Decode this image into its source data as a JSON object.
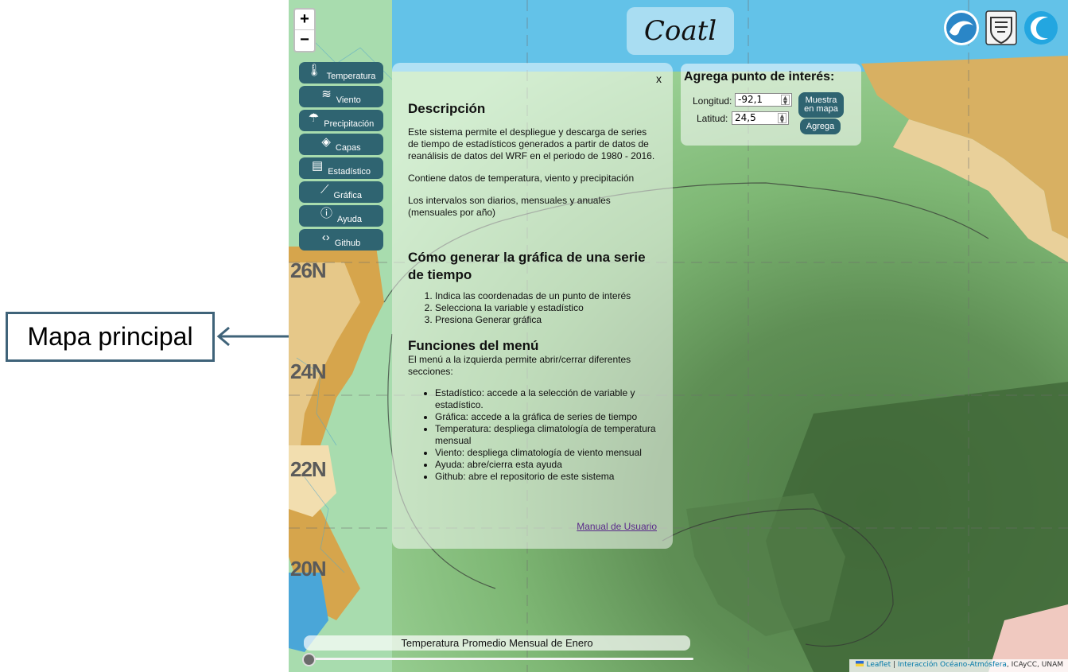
{
  "annotation": {
    "label": "Mapa principal"
  },
  "map": {
    "lat_labels": [
      "26N",
      "24N",
      "22N",
      "20N"
    ],
    "zoom": {
      "in_label": "+",
      "out_label": "−"
    }
  },
  "app": {
    "title": "Coatl"
  },
  "menu": {
    "items": [
      {
        "label": "Temperatura",
        "icon": "thermometer-icon",
        "glyph": "🌡"
      },
      {
        "label": "Viento",
        "icon": "wind-icon",
        "glyph": "≋"
      },
      {
        "label": "Precipitación",
        "icon": "rain-cloud-icon",
        "glyph": "☂"
      },
      {
        "label": "Capas",
        "icon": "layers-icon",
        "glyph": "◈"
      },
      {
        "label": "Estadístico",
        "icon": "document-icon",
        "glyph": "▤"
      },
      {
        "label": "Gráfica",
        "icon": "line-chart-icon",
        "glyph": "⟋"
      },
      {
        "label": "Ayuda",
        "icon": "info-icon",
        "glyph": "ⓘ"
      },
      {
        "label": "Github",
        "icon": "code-icon",
        "glyph": "‹›"
      }
    ]
  },
  "help": {
    "close_label": "x",
    "description_title": "Descripción",
    "description_p1": "Este sistema permite el despliegue y descarga de series de tiempo de estadísticos generados a partir de datos de reanálisis de datos del WRF en el periodo de 1980 - 2016.",
    "description_p2": "Contiene datos de temperatura, viento y precipitación",
    "description_p3": "Los intervalos son diarios, mensuales y anuales (mensuales por año)",
    "howto_title": "Cómo generar la gráfica de una serie de tiempo",
    "howto_steps": [
      "Indica las coordenadas de un punto de interés",
      "Selecciona la variable y estadístico",
      "Presiona Generar gráfica"
    ],
    "functions_title": "Funciones del menú",
    "functions_intro": "El menú a la izquierda permite abrir/cerrar diferentes secciones:",
    "functions_list": [
      "Estadístico: accede a la selección de variable y estadístico.",
      "Gráfica: accede a la gráfica de series de tiempo",
      "Temperatura: despliega climatología de temperatura mensual",
      "Viento: despliega climatología de viento mensual",
      "Ayuda: abre/cierra esta ayuda",
      "Github: abre el repositorio de este sistema"
    ],
    "manual_link": "Manual de Usuario"
  },
  "poi": {
    "title": "Agrega punto de interés:",
    "longitude_label": "Longitud:",
    "longitude_value": "-92,1",
    "latitude_label": "Latitud:",
    "latitude_value": "24,5",
    "show_button": "Muestra en mapa",
    "add_button": "Agrega"
  },
  "timebar": {
    "label": "Temperatura Promedio Mensual de Enero"
  },
  "attribution": {
    "leaflet": "Leaflet",
    "separator": " | ",
    "link": "Interacción Océano-Atmósfera",
    "suffix": ", ICAyCC, UNAM"
  },
  "colors": {
    "menu_bg": "#2f6471",
    "annotation_border": "#3f6379",
    "land_warm": "#d9a84f",
    "sea_green": "#8ec98c",
    "sea_dark": "#3f6a3a",
    "coast_blue": "#55b6e6"
  }
}
